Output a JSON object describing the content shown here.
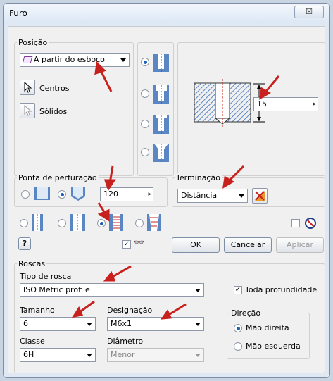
{
  "window": {
    "title": "Furo",
    "close_glyph": "☒"
  },
  "posicao": {
    "group_label": "Posição",
    "combo_value": "A partir do esboço",
    "centros_label": "Centros",
    "solidos_label": "Sólidos"
  },
  "preview": {
    "depth_value": "15"
  },
  "ponta": {
    "group_label": "Ponta de perfuração",
    "angle_value": "120"
  },
  "terminacao": {
    "group_label": "Terminação",
    "combo_value": "Distância"
  },
  "buttons": {
    "ok": "OK",
    "cancel": "Cancelar",
    "apply": "Aplicar",
    "help_glyph": "?"
  },
  "roscas": {
    "group_label": "Roscas",
    "tipo_label": "Tipo de rosca",
    "tipo_value": "ISO Metric profile",
    "full_depth_label": "Toda profundidade",
    "tamanho_label": "Tamanho",
    "tamanho_value": "6",
    "designacao_label": "Designação",
    "designacao_value": "M6x1",
    "classe_label": "Classe",
    "classe_value": "6H",
    "diametro_label": "Diâmetro",
    "diametro_value": "Menor",
    "direcao_label": "Direção",
    "right_hand_label": "Mão direita",
    "left_hand_label": "Mão esquerda"
  },
  "colors": {
    "accent": "#1a5fb4",
    "hatch": "#5b86c4",
    "arrow": "#c8201c"
  }
}
